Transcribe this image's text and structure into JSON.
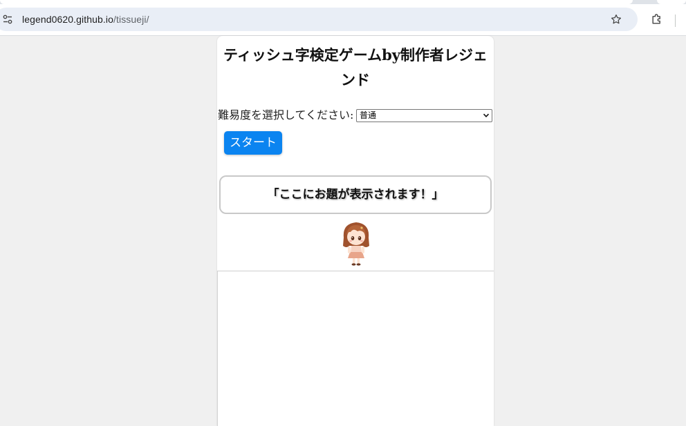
{
  "browser": {
    "url_host": "legend0620.github.io",
    "url_path": "/tissueji/",
    "icons": {
      "site_info": "tune-icon",
      "bookmark": "star-icon",
      "extensions": "puzzle-icon"
    }
  },
  "page": {
    "title": "ティッシュ字検定ゲームby制作者レジェンド",
    "difficulty_label": "難易度を選択してください:",
    "difficulty_selected": "普通",
    "start_button": "スタート",
    "prompt_text": "「ここにお題が表示されます！」",
    "accent_color": "#0b84f0"
  }
}
